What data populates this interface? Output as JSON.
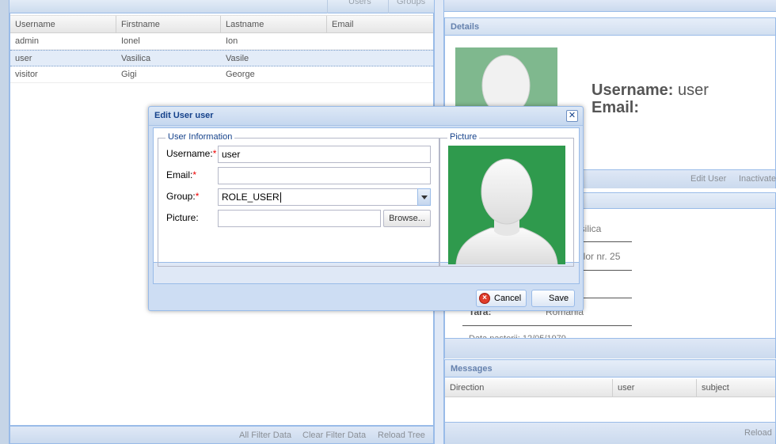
{
  "top_tabs": {
    "users": "Users",
    "groups": "Groups"
  },
  "users_grid": {
    "columns": [
      "Username",
      "Firstname",
      "Lastname",
      "Email"
    ],
    "rows": [
      {
        "username": "admin",
        "firstname": "Ionel",
        "lastname": "Ion",
        "email": ""
      },
      {
        "username": "user",
        "firstname": "Vasilica",
        "lastname": "Vasile",
        "email": ""
      },
      {
        "username": "visitor",
        "firstname": "Gigi",
        "lastname": "George",
        "email": ""
      }
    ],
    "selected_row": 1,
    "footer": {
      "all_filter": "All Filter Data",
      "clear_filter": "Clear Filter Data",
      "reload_tree": "Reload Tree"
    }
  },
  "details": {
    "title": "Details",
    "username_label": "Username:",
    "username_value": "user",
    "email_label": "Email:",
    "email_value": "",
    "toolbar": {
      "edit_user": "Edit User",
      "inactivate": "Inactivate"
    }
  },
  "info": {
    "firstname_partial": "asilica",
    "address_partial": "elor nr. 25",
    "country_label": "Tara:",
    "country_value": "Romania",
    "birthdate_partial": "Data nasterii: 12/05/1979"
  },
  "messages": {
    "title": "Messages",
    "columns": [
      "Direction",
      "user",
      "subject"
    ],
    "footer_reload": "Reload"
  },
  "dialog": {
    "title": "Edit User user",
    "fieldset_info": "User Information",
    "fieldset_picture": "Picture",
    "username_label": "Username:",
    "username_value": "user",
    "email_label": "Email:",
    "email_value": "",
    "group_label": "Group:",
    "group_value": "ROLE_USER",
    "picture_label": "Picture:",
    "picture_value": "",
    "browse_label": "Browse...",
    "cancel_label": "Cancel",
    "save_label": "Save",
    "required_mark": "*",
    "close_glyph": "✕"
  },
  "colors": {
    "accent": "#15428b",
    "panel_border": "#99bbe8",
    "picture_bg": "#2f9a4d",
    "required": "#ee0000"
  }
}
